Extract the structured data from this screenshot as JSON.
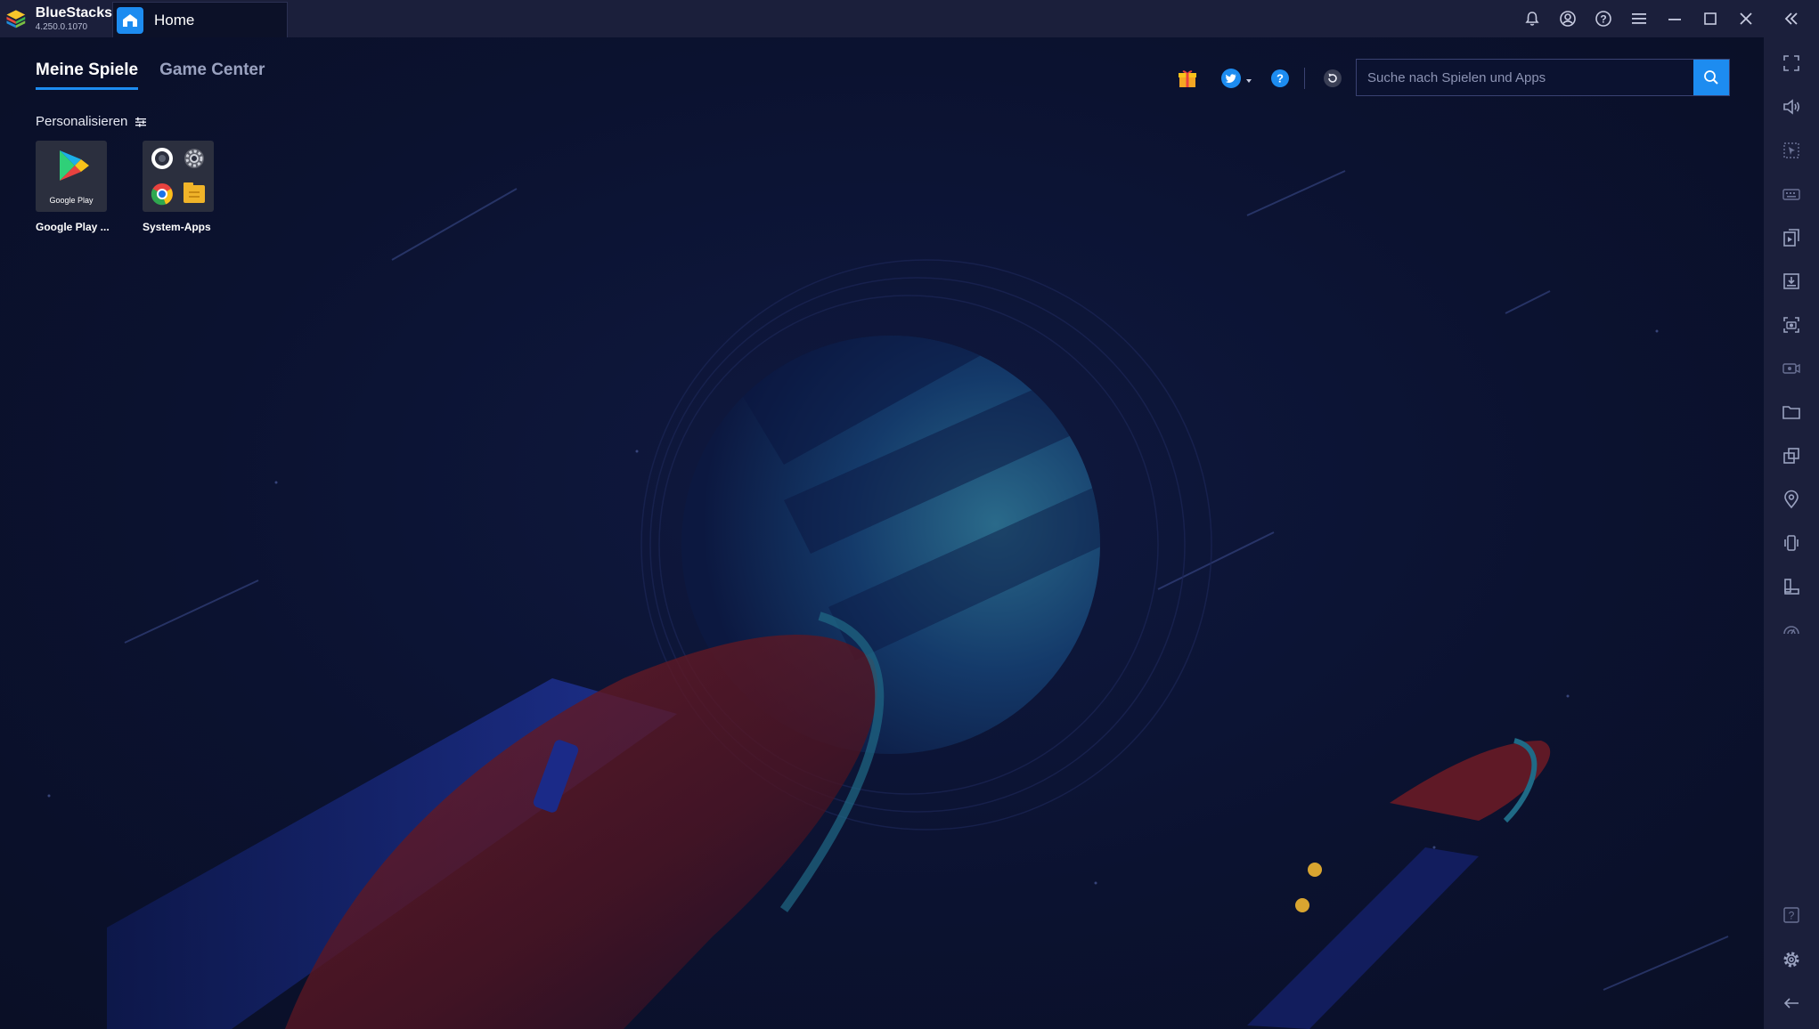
{
  "titlebar": {
    "brand_name": "BlueStacks",
    "brand_version": "4.250.0.1070",
    "tab_label": "Home",
    "controls": [
      "bell-icon",
      "account-icon",
      "help-icon",
      "menu-icon",
      "minimize-icon",
      "maximize-icon",
      "close-icon",
      "collapse-sidebar-icon"
    ]
  },
  "nav": {
    "tabs": [
      {
        "label": "Meine Spiele",
        "active": true
      },
      {
        "label": "Game Center",
        "active": false
      }
    ]
  },
  "personalize_label": "Personalisieren",
  "apps": [
    {
      "label": "Google Play ...",
      "icon_text": "Google Play"
    },
    {
      "label": "System-Apps"
    }
  ],
  "search": {
    "placeholder": "Suche nach Spielen und Apps",
    "value": ""
  },
  "sidebar": {
    "top_tools": [
      "fullscreen-icon",
      "volume-icon",
      "pointer-icon",
      "keyboard-icon",
      "multi-instance-icon",
      "apk-install-icon",
      "screenshot-icon",
      "record-icon",
      "folder-icon",
      "copy-window-icon",
      "location-icon",
      "shake-icon",
      "rotate-icon",
      "eco-mode-icon"
    ],
    "bottom_tools": [
      "sidebar-help-icon",
      "settings-icon",
      "back-icon"
    ]
  },
  "colors": {
    "accent": "#1d8cf0",
    "titlebar": "#1b1f3b",
    "background": "#0c1128"
  }
}
